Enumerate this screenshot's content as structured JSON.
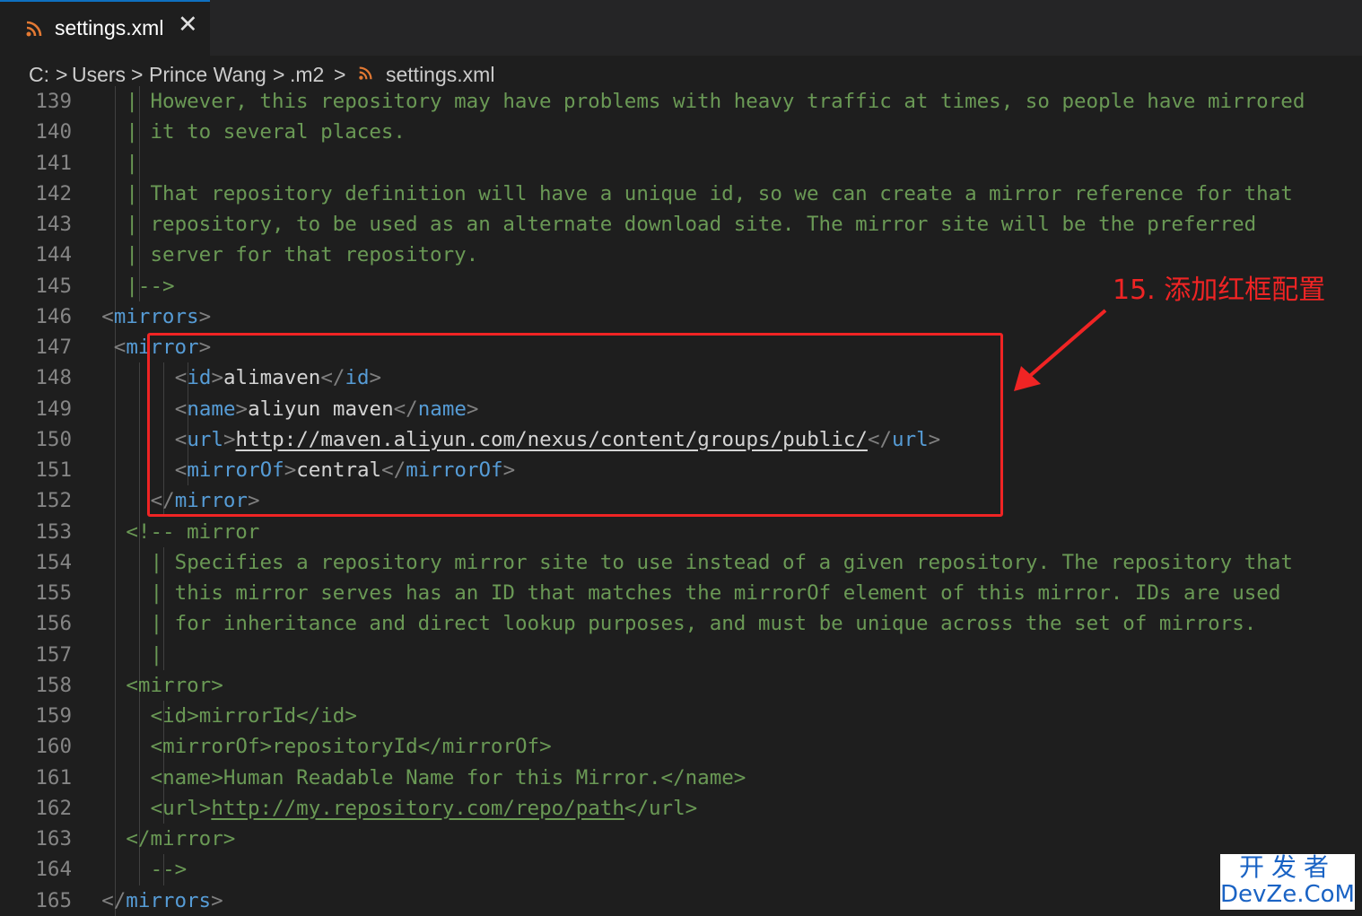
{
  "tab": {
    "title": "settings.xml",
    "close_glyph": "✕",
    "icon": "rss-icon"
  },
  "breadcrumb": {
    "parts": [
      "C:",
      "Users",
      "Prince Wang",
      ".m2",
      "settings.xml"
    ],
    "separator": ">"
  },
  "annotation": {
    "text": "15. 添加红框配置"
  },
  "watermark": {
    "line1": "开发者",
    "line2": "DevZe.CoM"
  },
  "colors": {
    "comment": "#6a9955",
    "tag": "#569cd6",
    "text": "#d4d4d4",
    "punct": "#808080",
    "annotation": "#f02424"
  },
  "editor": {
    "lines": [
      {
        "n": "139",
        "indent": 7,
        "segments": [
          {
            "t": "| However, this repository may have problems with heavy traffic at times, so people have mirrored",
            "c": "com"
          }
        ]
      },
      {
        "n": "140",
        "indent": 7,
        "segments": [
          {
            "t": "| it to several places.",
            "c": "com"
          }
        ]
      },
      {
        "n": "141",
        "indent": 7,
        "segments": [
          {
            "t": "|",
            "c": "com"
          }
        ]
      },
      {
        "n": "142",
        "indent": 7,
        "segments": [
          {
            "t": "| That repository definition will have a unique id, so we can create a mirror reference for that",
            "c": "com"
          }
        ]
      },
      {
        "n": "143",
        "indent": 7,
        "segments": [
          {
            "t": "| repository, to be used as an alternate download site. The mirror site will be the preferred",
            "c": "com"
          }
        ]
      },
      {
        "n": "144",
        "indent": 7,
        "segments": [
          {
            "t": "| server for that repository.",
            "c": "com"
          }
        ]
      },
      {
        "n": "145",
        "indent": 7,
        "segments": [
          {
            "t": "|-->",
            "c": "com"
          }
        ]
      },
      {
        "n": "146",
        "indent": 6,
        "segments": [
          {
            "t": "<",
            "c": "punct"
          },
          {
            "t": "mirrors",
            "c": "tag"
          },
          {
            "t": ">",
            "c": "punct"
          }
        ]
      },
      {
        "n": "147",
        "indent": 6.5,
        "segments": [
          {
            "t": "<",
            "c": "punct"
          },
          {
            "t": "mirror",
            "c": "tag"
          },
          {
            "t": ">",
            "c": "punct"
          }
        ]
      },
      {
        "n": "148",
        "indent": 9,
        "segments": [
          {
            "t": "<",
            "c": "punct"
          },
          {
            "t": "id",
            "c": "tag"
          },
          {
            "t": ">",
            "c": "punct"
          },
          {
            "t": "alimaven",
            "c": "text"
          },
          {
            "t": "</",
            "c": "punct"
          },
          {
            "t": "id",
            "c": "tag"
          },
          {
            "t": ">",
            "c": "punct"
          }
        ]
      },
      {
        "n": "149",
        "indent": 9,
        "segments": [
          {
            "t": "<",
            "c": "punct"
          },
          {
            "t": "name",
            "c": "tag"
          },
          {
            "t": ">",
            "c": "punct"
          },
          {
            "t": "aliyun maven",
            "c": "text"
          },
          {
            "t": "</",
            "c": "punct"
          },
          {
            "t": "name",
            "c": "tag"
          },
          {
            "t": ">",
            "c": "punct"
          }
        ]
      },
      {
        "n": "150",
        "indent": 9,
        "segments": [
          {
            "t": "<",
            "c": "punct"
          },
          {
            "t": "url",
            "c": "tag"
          },
          {
            "t": ">",
            "c": "punct"
          },
          {
            "t": "http://maven.aliyun.com/nexus/content/groups/public/",
            "c": "text",
            "u": true
          },
          {
            "t": "</",
            "c": "punct"
          },
          {
            "t": "url",
            "c": "tag"
          },
          {
            "t": ">",
            "c": "punct"
          }
        ]
      },
      {
        "n": "151",
        "indent": 9,
        "segments": [
          {
            "t": "<",
            "c": "punct"
          },
          {
            "t": "mirrorOf",
            "c": "tag"
          },
          {
            "t": ">",
            "c": "punct"
          },
          {
            "t": "central",
            "c": "text"
          },
          {
            "t": "</",
            "c": "punct"
          },
          {
            "t": "mirrorOf",
            "c": "tag"
          },
          {
            "t": ">",
            "c": "punct"
          }
        ]
      },
      {
        "n": "152",
        "indent": 8,
        "segments": [
          {
            "t": "</",
            "c": "punct"
          },
          {
            "t": "mirror",
            "c": "tag"
          },
          {
            "t": ">",
            "c": "punct"
          }
        ]
      },
      {
        "n": "153",
        "indent": 7,
        "segments": [
          {
            "t": "<!-- mirror",
            "c": "com"
          }
        ]
      },
      {
        "n": "154",
        "indent": 8,
        "segments": [
          {
            "t": "| Specifies a repository mirror site to use instead of a given repository. The repository that",
            "c": "com"
          }
        ]
      },
      {
        "n": "155",
        "indent": 8,
        "segments": [
          {
            "t": "| this mirror serves has an ID that matches the mirrorOf element of this mirror. IDs are used",
            "c": "com"
          }
        ]
      },
      {
        "n": "156",
        "indent": 8,
        "segments": [
          {
            "t": "| for inheritance and direct lookup purposes, and must be unique across the set of mirrors.",
            "c": "com"
          }
        ]
      },
      {
        "n": "157",
        "indent": 8,
        "segments": [
          {
            "t": "|",
            "c": "com"
          }
        ]
      },
      {
        "n": "158",
        "indent": 7,
        "segments": [
          {
            "t": "<mirror>",
            "c": "com"
          }
        ]
      },
      {
        "n": "159",
        "indent": 8,
        "segments": [
          {
            "t": "<id>mirrorId</id>",
            "c": "com"
          }
        ]
      },
      {
        "n": "160",
        "indent": 8,
        "segments": [
          {
            "t": "<mirrorOf>repositoryId</mirrorOf>",
            "c": "com"
          }
        ]
      },
      {
        "n": "161",
        "indent": 8,
        "segments": [
          {
            "t": "<name>Human Readable Name for this Mirror.</name>",
            "c": "com"
          }
        ]
      },
      {
        "n": "162",
        "indent": 8,
        "segments": [
          {
            "t": "<url>",
            "c": "com"
          },
          {
            "t": "http://my.repository.com/repo/path",
            "c": "com",
            "u": true
          },
          {
            "t": "</url>",
            "c": "com"
          }
        ]
      },
      {
        "n": "163",
        "indent": 7,
        "segments": [
          {
            "t": "</mirror>",
            "c": "com"
          }
        ]
      },
      {
        "n": "164",
        "indent": 8,
        "segments": [
          {
            "t": "-->",
            "c": "com"
          }
        ]
      },
      {
        "n": "165",
        "indent": 6,
        "segments": [
          {
            "t": "</",
            "c": "punct"
          },
          {
            "t": "mirrors",
            "c": "tag"
          },
          {
            "t": ">",
            "c": "punct"
          }
        ]
      }
    ]
  }
}
